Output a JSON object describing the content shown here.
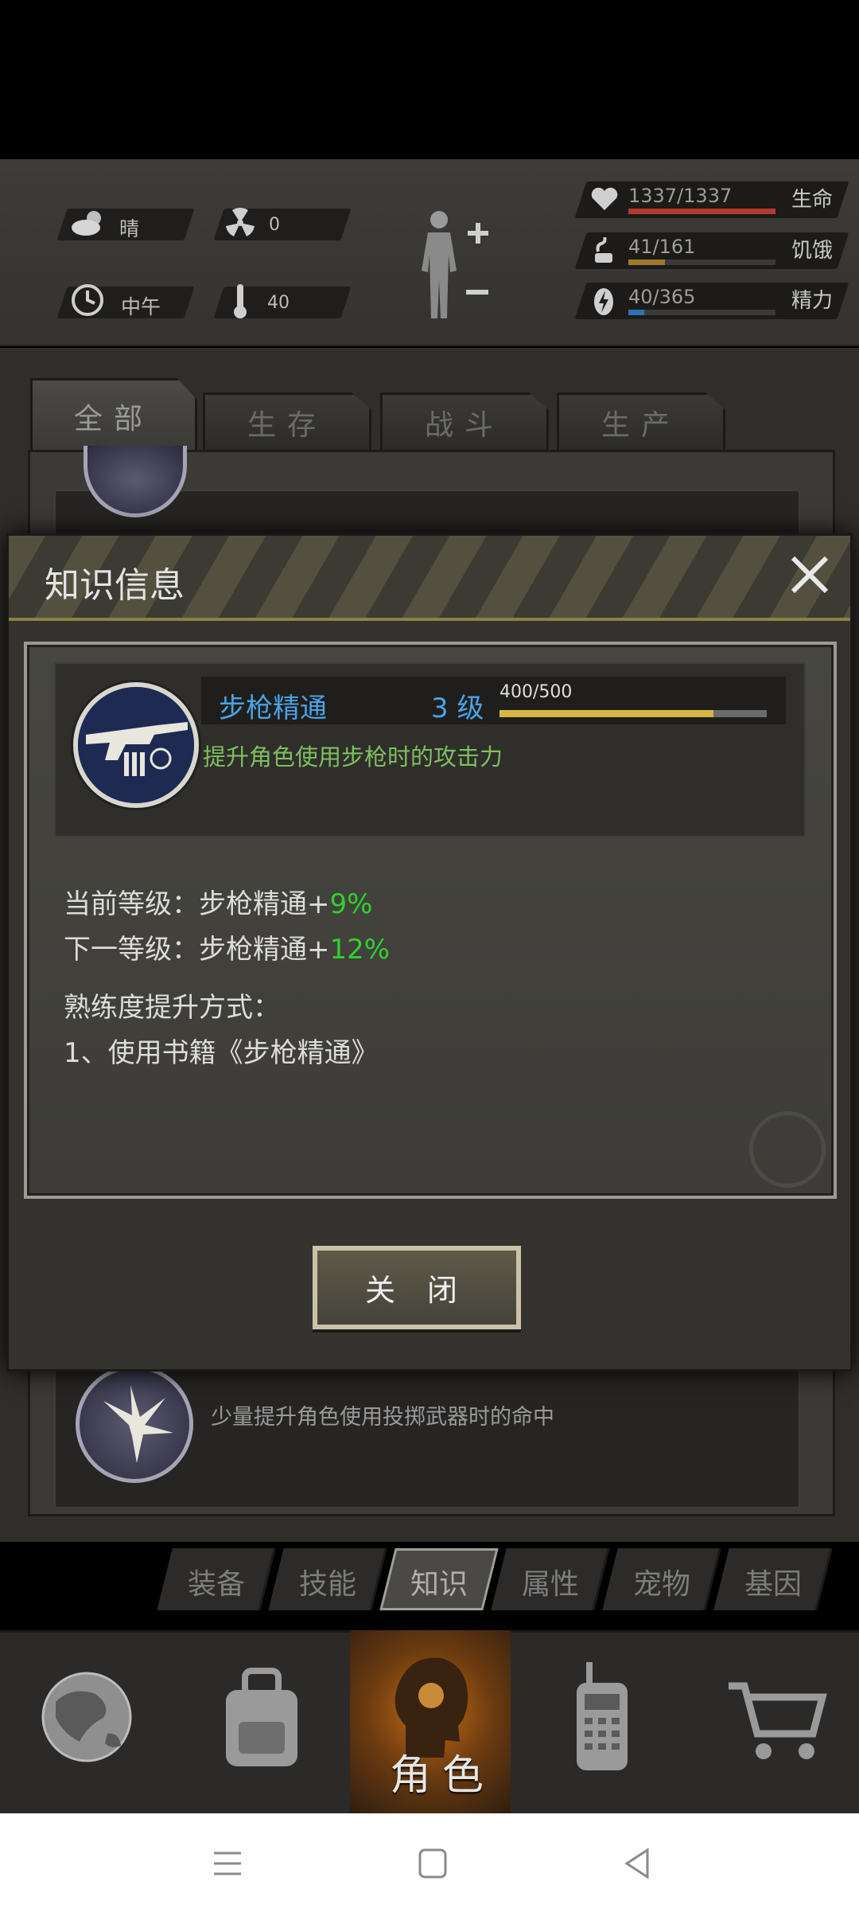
{
  "hud": {
    "weather": "晴",
    "radiation": "0",
    "time_of_day": "中午",
    "temperature": "40",
    "stats": [
      {
        "name": "生命",
        "value": "1337/1337",
        "fraction": 1.0,
        "color": "#b33a2f"
      },
      {
        "name": "饥饿",
        "value": "41/161",
        "fraction": 0.25,
        "color": "#9c7a2c"
      },
      {
        "name": "精力",
        "value": "40/365",
        "fraction": 0.11,
        "color": "#2f6fb3"
      }
    ]
  },
  "category_tabs": [
    {
      "label": "全部",
      "active": true
    },
    {
      "label": "生存",
      "active": false
    },
    {
      "label": "战斗",
      "active": false
    },
    {
      "label": "生产",
      "active": false
    }
  ],
  "background_item": {
    "description": "少量提升角色使用投掷武器时的命中"
  },
  "modal": {
    "title": "知识信息",
    "skill": {
      "name": "步枪精通",
      "level": "3 级",
      "exp_text": "400/500",
      "exp_fraction": 0.8,
      "description": "提升角色使用步枪时的攻击力"
    },
    "current_level_prefix": "当前等级：步枪精通+",
    "current_level_value": "9%",
    "next_level_prefix": "下一等级：步枪精通+",
    "next_level_value": "12%",
    "method_title": "熟练度提升方式：",
    "method_1": "1、使用书籍《步枪精通》",
    "close_button": "关 闭"
  },
  "sub_tabs": [
    {
      "label": "装备",
      "active": false
    },
    {
      "label": "技能",
      "active": false
    },
    {
      "label": "知识",
      "active": true
    },
    {
      "label": "属性",
      "active": false
    },
    {
      "label": "宠物",
      "active": false
    },
    {
      "label": "基因",
      "active": false
    }
  ],
  "bottom_nav": {
    "active_label": "角色"
  }
}
